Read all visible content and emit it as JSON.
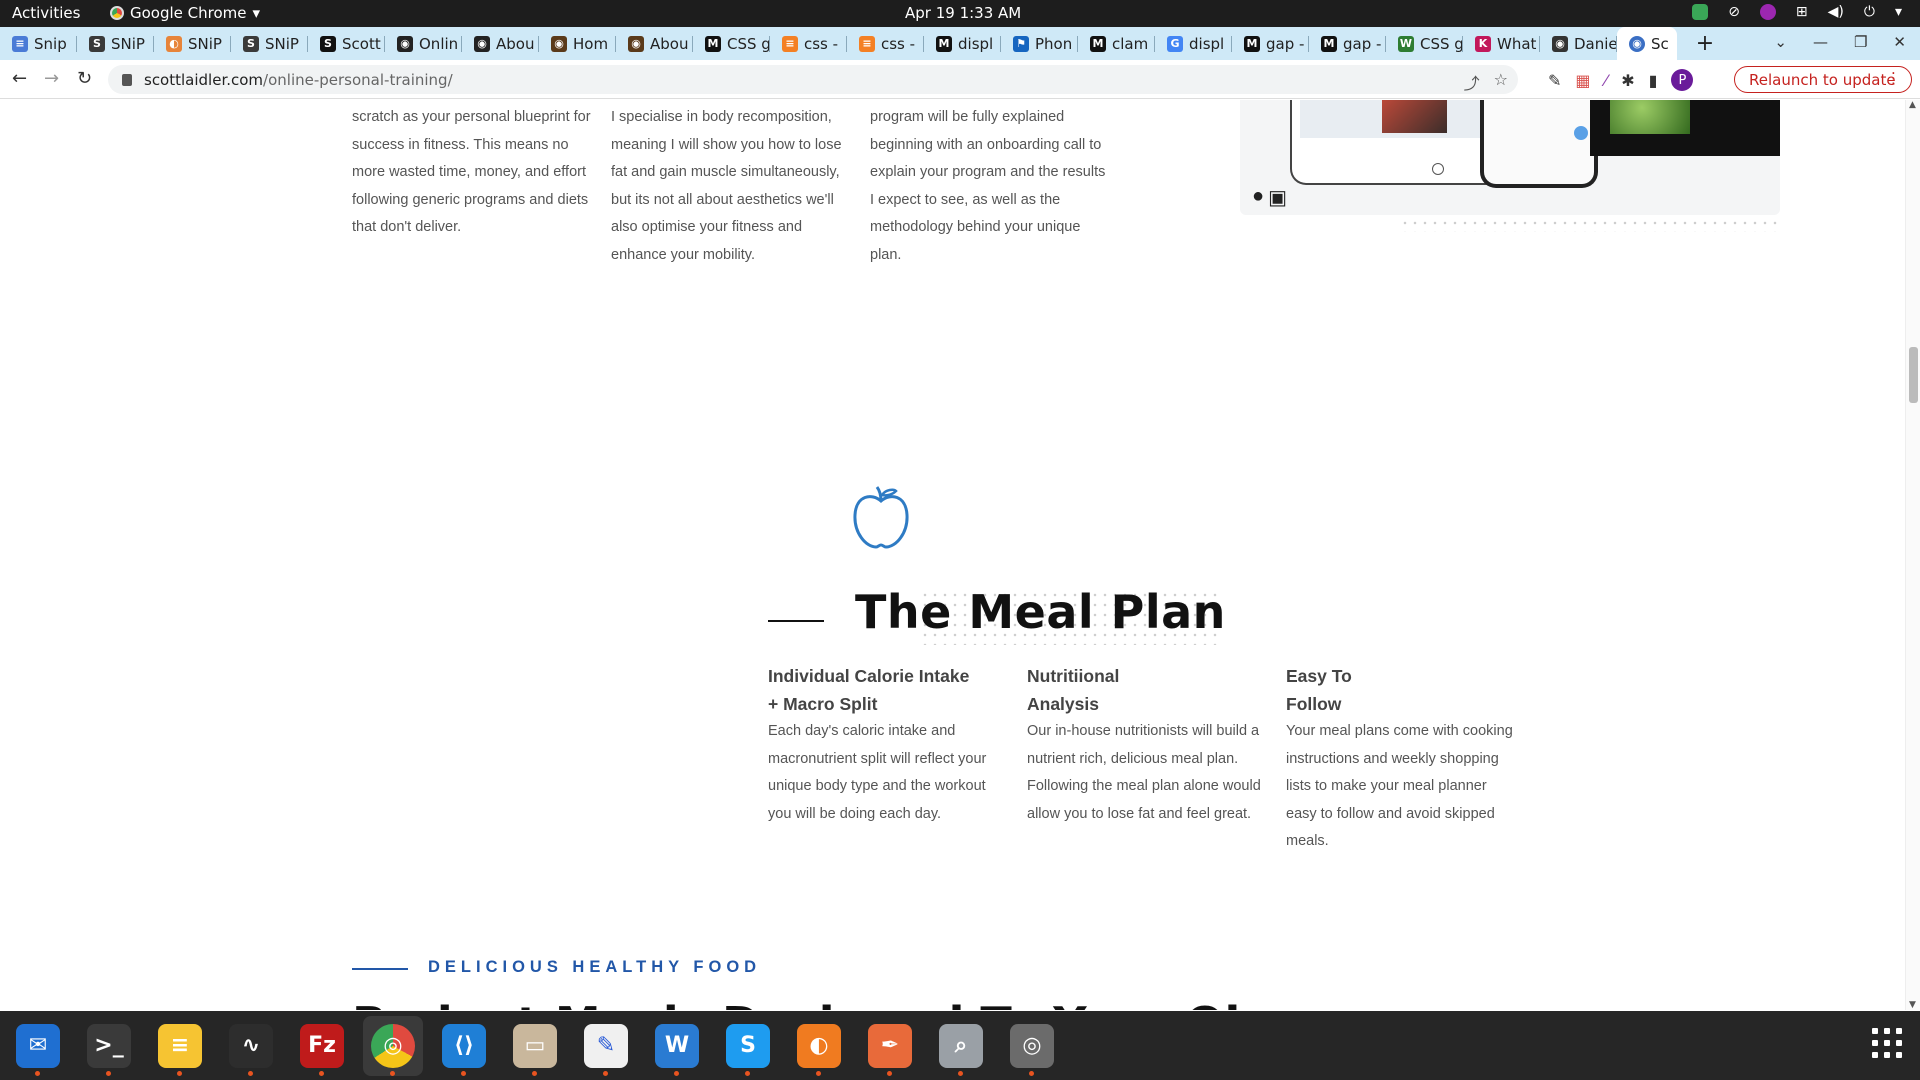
{
  "topbar": {
    "activities": "Activities",
    "app_name": "Google Chrome",
    "clock": "Apr 19  1:33 AM"
  },
  "tabs": [
    {
      "label": "Snip",
      "favicon_color": "#4a7bd6",
      "glyph": "≡"
    },
    {
      "label": "SNiP",
      "favicon_color": "#3a3a3a",
      "glyph": "S"
    },
    {
      "label": "SNiP",
      "favicon_color": "#e7843a",
      "glyph": "◐"
    },
    {
      "label": "SNiP",
      "favicon_color": "#3a3a3a",
      "glyph": "S"
    },
    {
      "label": "Scott",
      "favicon_color": "#111111",
      "glyph": "S"
    },
    {
      "label": "Onlin",
      "favicon_color": "#222222",
      "glyph": "◉"
    },
    {
      "label": "Abou",
      "favicon_color": "#222222",
      "glyph": "◉"
    },
    {
      "label": "Hom",
      "favicon_color": "#5a3a1a",
      "glyph": "◉"
    },
    {
      "label": "Abou",
      "favicon_color": "#5a3a1a",
      "glyph": "◉"
    },
    {
      "label": "CSS g",
      "favicon_color": "#111111",
      "glyph": "M"
    },
    {
      "label": "css -",
      "favicon_color": "#f48024",
      "glyph": "≡"
    },
    {
      "label": "css -",
      "favicon_color": "#f48024",
      "glyph": "≡"
    },
    {
      "label": "displ",
      "favicon_color": "#111111",
      "glyph": "M"
    },
    {
      "label": "Phon",
      "favicon_color": "#1565c0",
      "glyph": "⚑"
    },
    {
      "label": "clam",
      "favicon_color": "#111111",
      "glyph": "M"
    },
    {
      "label": "displ",
      "favicon_color": "#4285f4",
      "glyph": "G"
    },
    {
      "label": "gap -",
      "favicon_color": "#111111",
      "glyph": "M"
    },
    {
      "label": "gap -",
      "favicon_color": "#111111",
      "glyph": "M"
    },
    {
      "label": "CSS g",
      "favicon_color": "#2e7d32",
      "glyph": "W"
    },
    {
      "label": "What",
      "favicon_color": "#c2185b",
      "glyph": "K"
    },
    {
      "label": "Danie",
      "favicon_color": "#333333",
      "glyph": "◉"
    }
  ],
  "active_tab": {
    "label": "Sc",
    "favicon_color": "#3b6fc4",
    "close": "✕"
  },
  "newtab_label": "+",
  "address": {
    "domain": "scottlaidler.com",
    "path": "/online-personal-training/"
  },
  "profile_initial": "P",
  "relaunch_label": "Relaunch to update",
  "intro_columns": [
    "scratch as your personal blueprint for success in fitness. This means no more wasted time, money, and effort following generic programs and diets that don't deliver.",
    "I specialise in body recomposition, meaning I will show you how to lose fat and gain muscle simultaneously, but its not all about aesthetics we'll also optimise your fitness and enhance your mobility.",
    "program will be fully explained beginning with an onboarding call to explain your program and the results I expect to see, as well as the methodology behind your unique plan."
  ],
  "meal_plan": {
    "title": "The Meal Plan",
    "features": [
      {
        "heading_line1": "Individual Calorie Intake",
        "heading_line2": "+ Macro Split",
        "body": "Each day's caloric intake and macronutrient split will reflect your unique body type and the workout you will be doing each day."
      },
      {
        "heading_line1": "Nutritiional",
        "heading_line2": "Analysis",
        "body": "Our in-house nutritionists will build a nutrient rich, delicious meal plan. Following the meal plan alone would allow you to lose fat and feel great."
      },
      {
        "heading_line1": "Easy To",
        "heading_line2": "Follow",
        "body": "Your meal plans come with cooking instructions and weekly shopping lists to make your meal planner easy to follow and avoid skipped meals."
      }
    ]
  },
  "next_section": {
    "eyebrow": "DELICIOUS HEALTHY FOOD",
    "heading_partial": "Budget Meals Designed To Your Ob"
  },
  "colors": {
    "accent_blue": "#2257a8",
    "apple_icon": "#2e7bc4",
    "relaunch_red": "#c5221f"
  },
  "dock": [
    {
      "name": "thunderbird",
      "color": "#1f6fd1",
      "glyph": "✉",
      "running": true
    },
    {
      "name": "terminal",
      "color": "#3a3a3a",
      "glyph": ">_",
      "running": true
    },
    {
      "name": "notes",
      "color": "#f6c432",
      "glyph": "≡",
      "running": true
    },
    {
      "name": "system-monitor",
      "color": "#2d2d2d",
      "glyph": "∿",
      "running": true
    },
    {
      "name": "filezilla",
      "color": "#bf1b1b",
      "glyph": "Fz",
      "running": true
    },
    {
      "name": "chrome",
      "color": "#ffffff",
      "glyph": "◎",
      "running": true
    },
    {
      "name": "vscode",
      "color": "#1f7fd6",
      "glyph": "⟨⟩",
      "running": true
    },
    {
      "name": "files",
      "color": "#c9b79c",
      "glyph": "▭",
      "running": true
    },
    {
      "name": "text-editor",
      "color": "#f0f0f0",
      "glyph": "✎",
      "running": true
    },
    {
      "name": "libreoffice-writer",
      "color": "#2a7bd2",
      "glyph": "W",
      "running": true
    },
    {
      "name": "skype",
      "color": "#1e9cf0",
      "glyph": "S",
      "running": true
    },
    {
      "name": "blender",
      "color": "#f07b20",
      "glyph": "◐",
      "running": true
    },
    {
      "name": "inkscape",
      "color": "#e86a3a",
      "glyph": "✒",
      "running": true
    },
    {
      "name": "image-viewer",
      "color": "#9aa0a6",
      "glyph": "⌕",
      "running": true
    },
    {
      "name": "disks",
      "color": "#6b6b6b",
      "glyph": "◎",
      "running": true
    }
  ]
}
